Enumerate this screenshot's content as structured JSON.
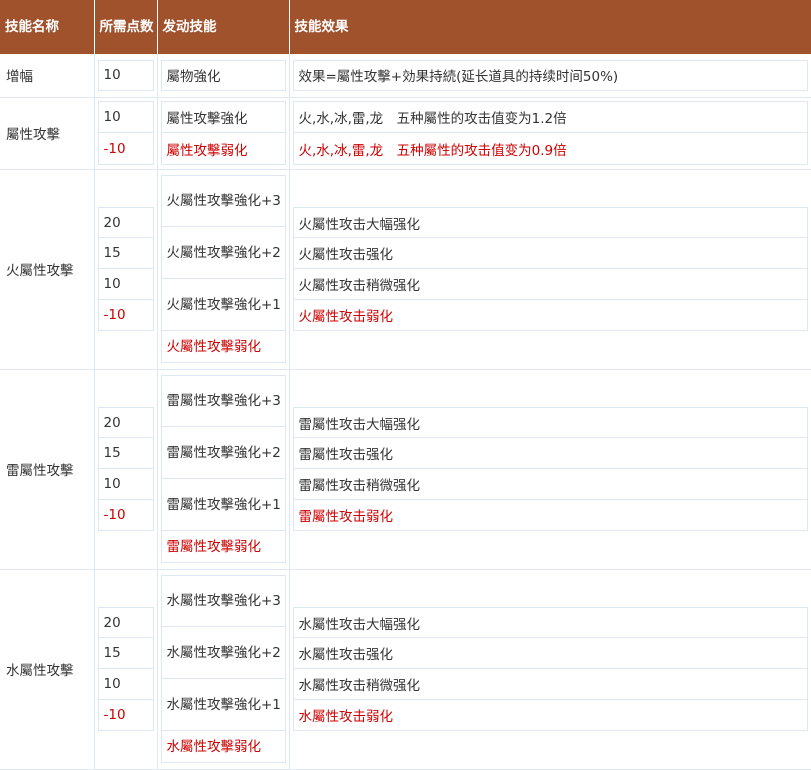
{
  "header": {
    "col1": "技能名称",
    "col2": "所需点数",
    "col3": "发动技能",
    "col4": "技能效果"
  },
  "rows": [
    {
      "name": "增幅",
      "points": [
        "10"
      ],
      "skills": [
        "屬物強化"
      ],
      "effects": [
        "效果=屬性攻擊+効果持続(延长道具的持续时间50%)"
      ]
    },
    {
      "name": "屬性攻擊",
      "points": [
        "10",
        "-10"
      ],
      "skills": [
        "屬性攻擊強化",
        "屬性攻擊弱化"
      ],
      "effects": [
        "火,水,冰,雷,龙　五种屬性的攻击值变为1.2倍",
        "火,水,冰,雷,龙　五种屬性的攻击值变为0.9倍"
      ]
    },
    {
      "name": "火屬性攻擊",
      "points": [
        "20",
        "15",
        "10",
        "-10"
      ],
      "skills": [
        "火屬性攻擊強化+3",
        "火屬性攻擊強化+2",
        "火屬性攻擊強化+1",
        "火屬性攻擊弱化"
      ],
      "effects": [
        "火屬性攻击大幅强化",
        "火屬性攻击强化",
        "火屬性攻击稍微强化",
        "火屬性攻击弱化"
      ]
    },
    {
      "name": "雷屬性攻擊",
      "points": [
        "20",
        "15",
        "10",
        "-10"
      ],
      "skills": [
        "雷屬性攻擊強化+3",
        "雷屬性攻擊強化+2",
        "雷屬性攻擊強化+1",
        "雷屬性攻擊弱化"
      ],
      "effects": [
        "雷屬性攻击大幅强化",
        "雷屬性攻击强化",
        "雷屬性攻击稍微强化",
        "雷屬性攻击弱化"
      ]
    },
    {
      "name": "水屬性攻擊",
      "points": [
        "20",
        "15",
        "10",
        "-10"
      ],
      "skills": [
        "水屬性攻擊強化+3",
        "水屬性攻擊強化+2",
        "水屬性攻擊強化+1",
        "水屬性攻擊弱化"
      ],
      "effects": [
        "水屬性攻击大幅强化",
        "水屬性攻击强化",
        "水屬性攻击稍微强化",
        "水屬性攻击弱化"
      ]
    }
  ],
  "colors": {
    "header_bg": "#a0522d",
    "header_text": "#ffffff",
    "negative_text": "#cc0000",
    "border": "#dde8f3"
  }
}
